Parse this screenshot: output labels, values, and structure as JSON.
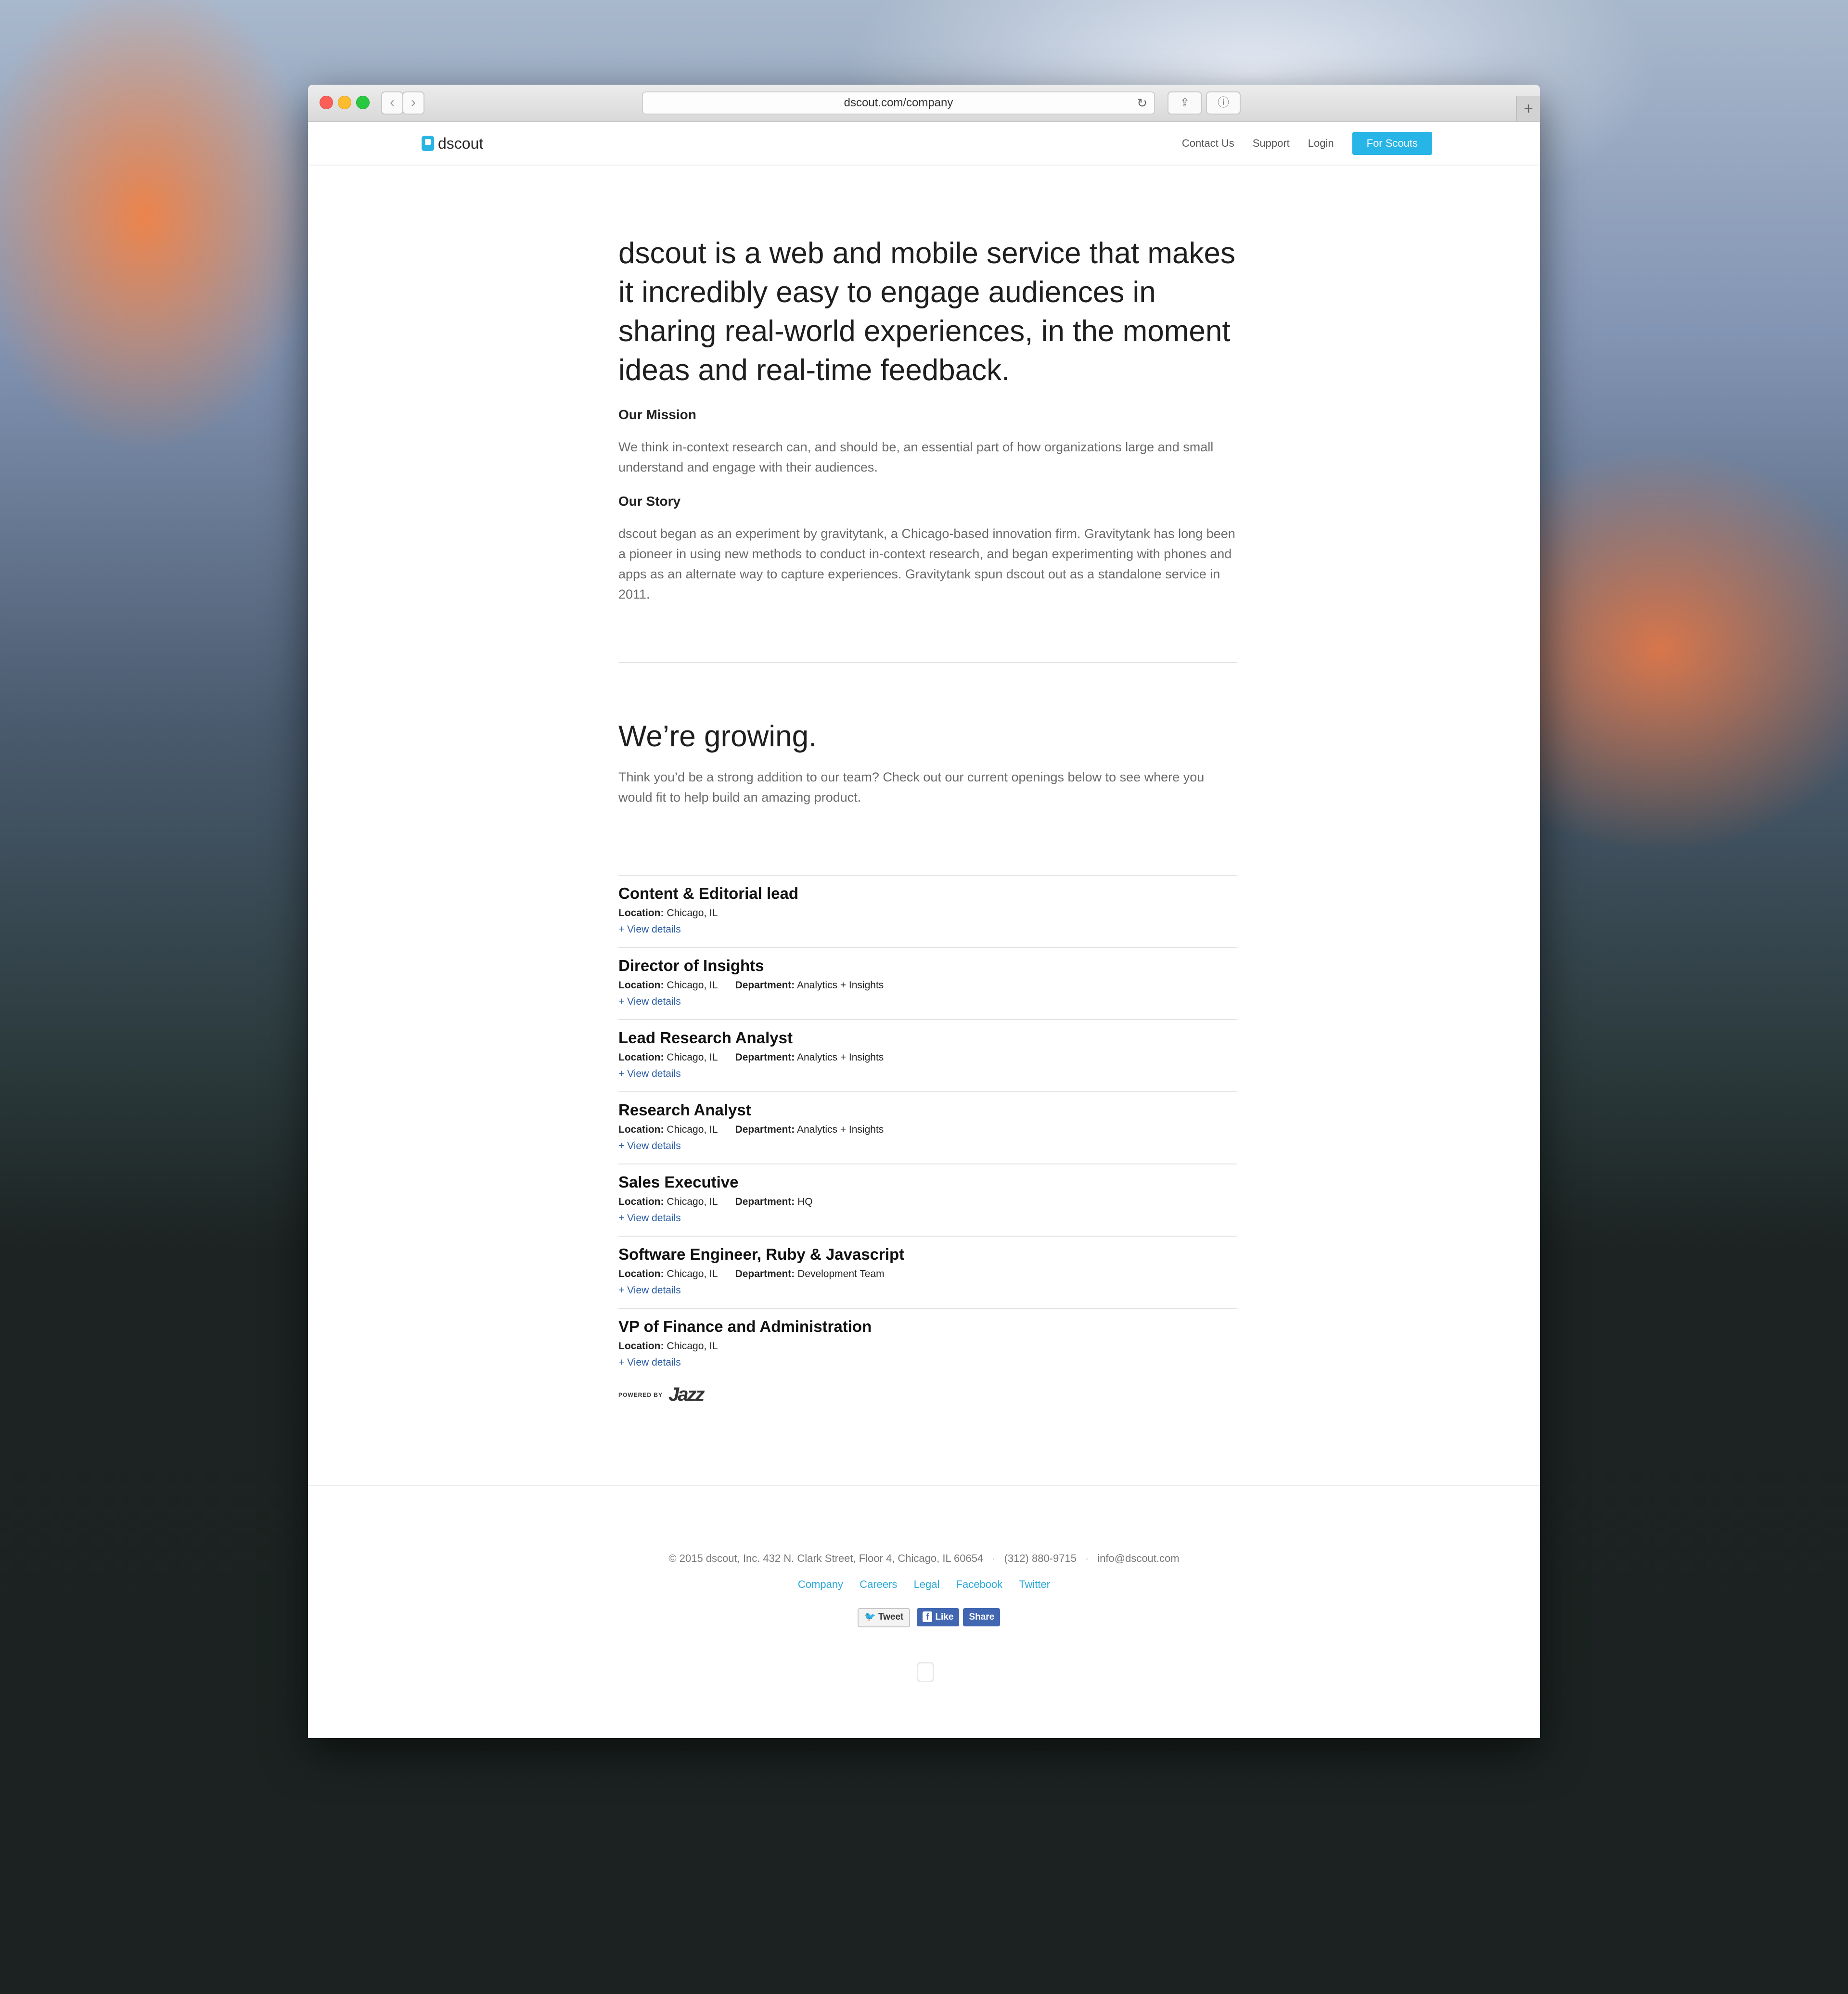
{
  "browser": {
    "url": "dscout.com/company",
    "back_icon": "‹",
    "forward_icon": "›",
    "reload_icon": "↻",
    "share_icon": "⇪",
    "info_icon": "ⓘ",
    "plus_icon": "+"
  },
  "nav": {
    "logo_text": "dscout",
    "links": [
      "Contact Us",
      "Support",
      "Login"
    ],
    "cta": "For Scouts"
  },
  "hero": {
    "text": "dscout is a web and mobile service that makes it incredibly easy to engage audiences in sharing real-world experiences, in the moment ideas and real-time feedback."
  },
  "mission": {
    "title": "Our Mission",
    "text": "We think in-context research can, and should be, an essential part of how organizations large and small understand and engage with their audiences."
  },
  "story": {
    "title": "Our Story",
    "text": "dscout began as an experiment by gravitytank, a Chicago-based innovation firm. Gravitytank has long been a pioneer in using new methods to conduct in-context research, and began experimenting with phones and apps as an alternate way to capture experiences. Gravitytank spun dscout out as a standalone service in 2011."
  },
  "growing": {
    "title": "We’re growing.",
    "text": "Think you’d be a strong addition to our team? Check out our current openings below to see where you would fit to help build an amazing product."
  },
  "jobs": [
    {
      "title": "Content & Editorial lead",
      "location_label": "Location:",
      "location": "Chicago, IL",
      "department_label": "",
      "department": "",
      "link": "+ View details"
    },
    {
      "title": "Director of Insights",
      "location_label": "Location:",
      "location": "Chicago, IL",
      "department_label": "Department:",
      "department": "Analytics + Insights",
      "link": "+ View details"
    },
    {
      "title": "Lead Research Analyst",
      "location_label": "Location:",
      "location": "Chicago, IL",
      "department_label": "Department:",
      "department": "Analytics + Insights",
      "link": "+ View details"
    },
    {
      "title": "Research Analyst",
      "location_label": "Location:",
      "location": "Chicago, IL",
      "department_label": "Department:",
      "department": "Analytics + Insights",
      "link": "+ View details"
    },
    {
      "title": "Sales Executive",
      "location_label": "Location:",
      "location": "Chicago, IL",
      "department_label": "Department:",
      "department": "HQ",
      "link": "+ View details"
    },
    {
      "title": "Software Engineer, Ruby & Javascript",
      "location_label": "Location:",
      "location": "Chicago, IL",
      "department_label": "Department:",
      "department": "Development Team",
      "link": "+ View details"
    },
    {
      "title": "VP of Finance and Administration",
      "location_label": "Location:",
      "location": "Chicago, IL",
      "department_label": "",
      "department": "",
      "link": "+ View details"
    }
  ],
  "powered": {
    "small": "POWERED BY",
    "brand": "Jazz"
  },
  "footer": {
    "copyright": "© 2015 dscout, Inc. 432 N. Clark Street, Floor 4, Chicago, IL 60654",
    "phone": "(312) 880-9715",
    "email": "info@dscout.com",
    "separator": "·",
    "links": [
      "Company",
      "Careers",
      "Legal",
      "Facebook",
      "Twitter"
    ],
    "tweet": "Tweet",
    "like": "Like",
    "share": "Share",
    "twitter_glyph": "🐦",
    "facebook_glyph": "f"
  },
  "colors": {
    "accent": "#27b4e6",
    "link": "#2b5da6",
    "facebook": "#4267b2"
  }
}
